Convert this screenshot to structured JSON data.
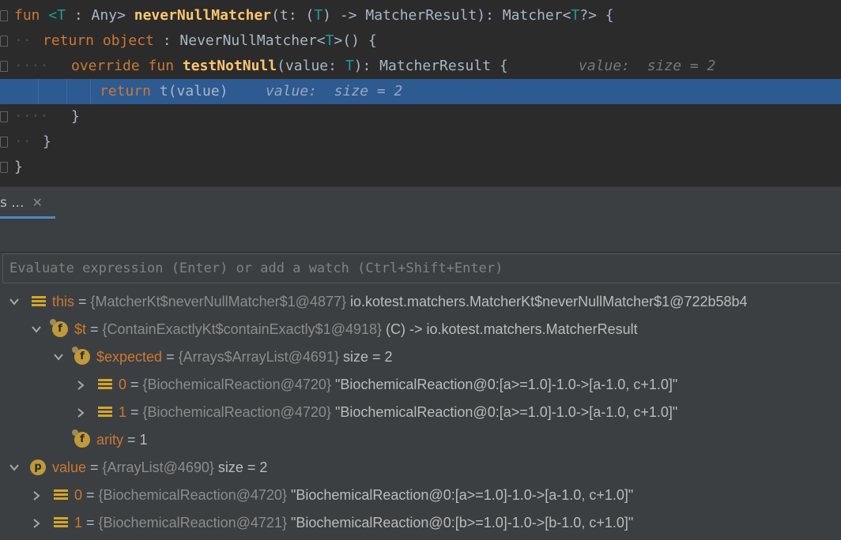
{
  "editor": {
    "lines": [
      {
        "tokens": [
          [
            "kw",
            "fun "
          ],
          [
            "tp",
            "<T"
          ],
          [
            "plain",
            " : Any> "
          ],
          [
            "fn",
            "neverNullMatcher"
          ],
          [
            "plain",
            "(t: ("
          ],
          [
            "tp",
            "T"
          ],
          [
            "plain",
            ") -> MatcherResult): Matcher<"
          ],
          [
            "tp",
            "T"
          ],
          [
            "plain",
            "?> {"
          ]
        ]
      },
      {
        "tokens": [
          [
            "kw",
            "return object"
          ],
          [
            "plain",
            " : NeverNullMatcher<"
          ],
          [
            "tp",
            "T"
          ],
          [
            "plain",
            ">() {"
          ]
        ]
      },
      {
        "tokens": [
          [
            "kw",
            "override fun "
          ],
          [
            "fn",
            "testNotNull"
          ],
          [
            "plain",
            "(value: "
          ],
          [
            "tp",
            "T"
          ],
          [
            "plain",
            "): MatcherResult {"
          ]
        ],
        "hint": "value:  size = 2"
      },
      {
        "tokens": [
          [
            "kw",
            "return "
          ],
          [
            "plain",
            "t(value)"
          ]
        ],
        "hint": "value:  size = 2"
      },
      {
        "tokens": [
          [
            "plain",
            "}"
          ]
        ]
      },
      {
        "tokens": [
          [
            "plain",
            "}"
          ]
        ]
      },
      {
        "tokens": [
          [
            "plain",
            "}"
          ]
        ]
      }
    ]
  },
  "panel": {
    "tab_label": "s ...",
    "tab_close": "✕",
    "eval_placeholder": "Evaluate expression (Enter) or add a watch (Ctrl+Shift+Enter)"
  },
  "variables": [
    {
      "name": "this",
      "eq": " = ",
      "ref": "{MatcherKt$neverNullMatcher$1@4877}",
      "value": " io.kotest.matchers.MatcherKt$neverNullMatcher$1@722b58b4"
    },
    {
      "name": "$t",
      "eq": " = ",
      "ref": "{ContainExactlyKt$containExactly$1@4918}",
      "value": " (C) -> io.kotest.matchers.MatcherResult"
    },
    {
      "name": "$expected",
      "eq": " = ",
      "ref": "{Arrays$ArrayList@4691}",
      "value": "  size = 2"
    },
    {
      "name": "0",
      "eq": " = ",
      "ref": "{BiochemicalReaction@4720}",
      "value": " \"BiochemicalReaction@0:[a>=1.0]-1.0->[a-1.0, c+1.0]\""
    },
    {
      "name": "1",
      "eq": " = ",
      "ref": "{BiochemicalReaction@4720}",
      "value": " \"BiochemicalReaction@0:[a>=1.0]-1.0->[a-1.0, c+1.0]\""
    },
    {
      "name": "arity",
      "eq": " = ",
      "ref": "",
      "value": "1"
    },
    {
      "name": "value",
      "eq": " = ",
      "ref": "{ArrayList@4690}",
      "value": "  size = 2"
    },
    {
      "name": "0",
      "eq": " = ",
      "ref": "{BiochemicalReaction@4720}",
      "value": " \"BiochemicalReaction@0:[a>=1.0]-1.0->[a-1.0, c+1.0]\""
    },
    {
      "name": "1",
      "eq": " = ",
      "ref": "{BiochemicalReaction@4721}",
      "value": " \"BiochemicalReaction@0:[b>=1.0]-1.0->[b-1.0, c+1.0]\""
    }
  ],
  "icons": {
    "field": "f",
    "param": "p"
  },
  "colors": {
    "keyword": "#cc7832",
    "function": "#ffc66d",
    "type_param": "#20999d",
    "highlight": "#2d5a91"
  }
}
